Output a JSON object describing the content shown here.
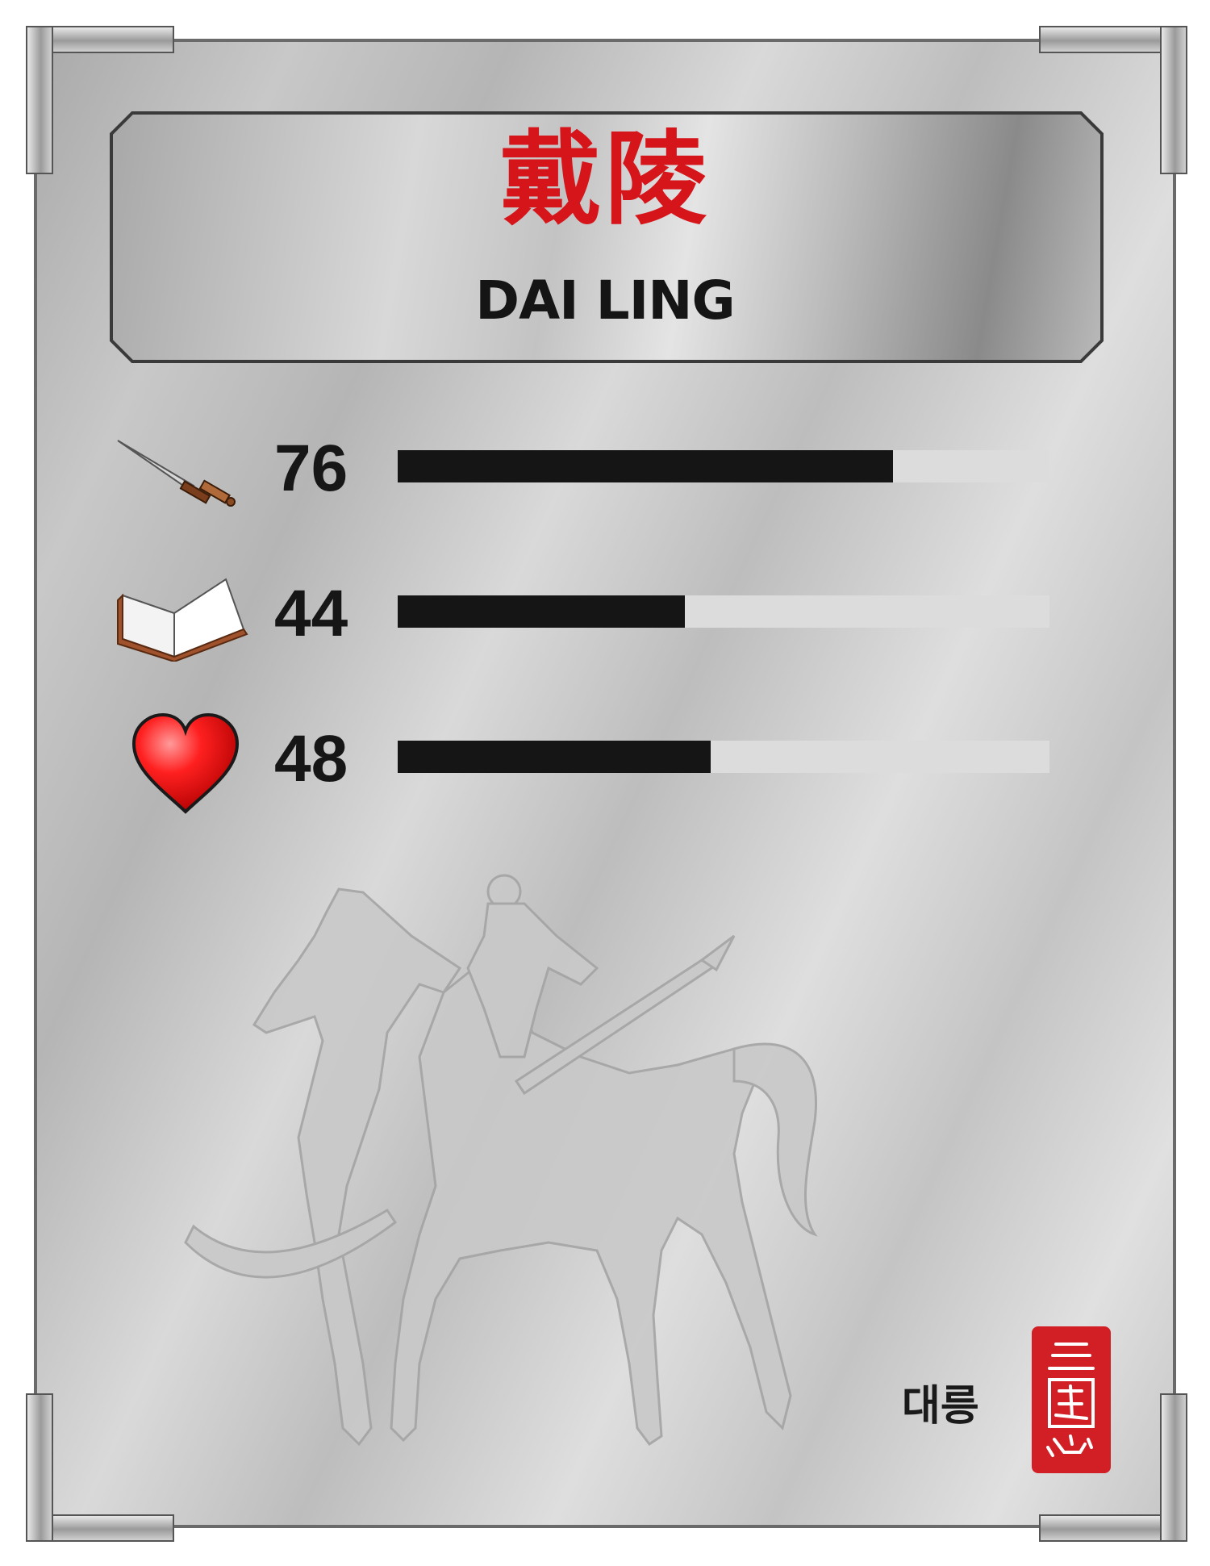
{
  "character": {
    "chinese_name": "戴陵",
    "english_name": "DAI LING",
    "korean_name": "대릉"
  },
  "stats": [
    {
      "icon": "sword-icon",
      "value": "76",
      "level": 76
    },
    {
      "icon": "book-icon",
      "value": "44",
      "level": 44
    },
    {
      "icon": "heart-icon",
      "value": "48",
      "level": 48
    }
  ],
  "seal": {
    "text": "三國志",
    "color": "#d21f26"
  },
  "colors": {
    "name_red": "#d6151b",
    "bar": "#151515",
    "track": "#dcdcdc"
  },
  "max_stat": 100
}
